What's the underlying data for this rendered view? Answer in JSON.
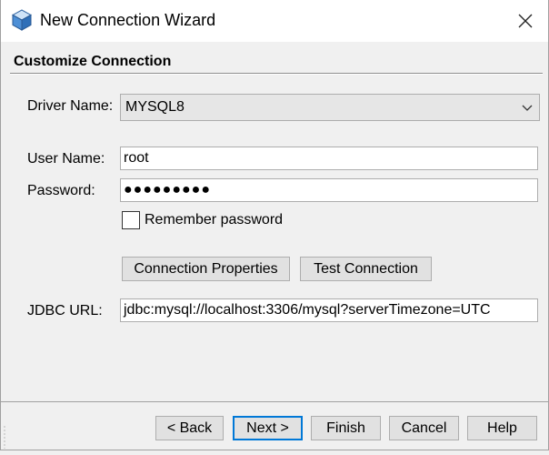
{
  "window": {
    "title": "New Connection Wizard"
  },
  "section": {
    "title": "Customize Connection"
  },
  "form": {
    "driver_label": "Driver Name:",
    "driver_value": "MYSQL8",
    "user_label": "User Name:",
    "user_value": "root",
    "password_label": "Password:",
    "password_value": "●●●●●●●●●",
    "remember_label": "Remember password",
    "remember_checked": false,
    "jdbc_label": "JDBC URL:",
    "jdbc_value": "jdbc:mysql://localhost:3306/mysql?serverTimezone=UTC"
  },
  "actions": {
    "connection_properties": "Connection Properties",
    "test_connection": "Test Connection"
  },
  "footer": {
    "back": "< Back",
    "next": "Next >",
    "finish": "Finish",
    "cancel": "Cancel",
    "help": "Help"
  },
  "icons": {
    "app": "netbeans-cube-icon",
    "close": "close-icon",
    "dropdown": "chevron-down-icon"
  }
}
